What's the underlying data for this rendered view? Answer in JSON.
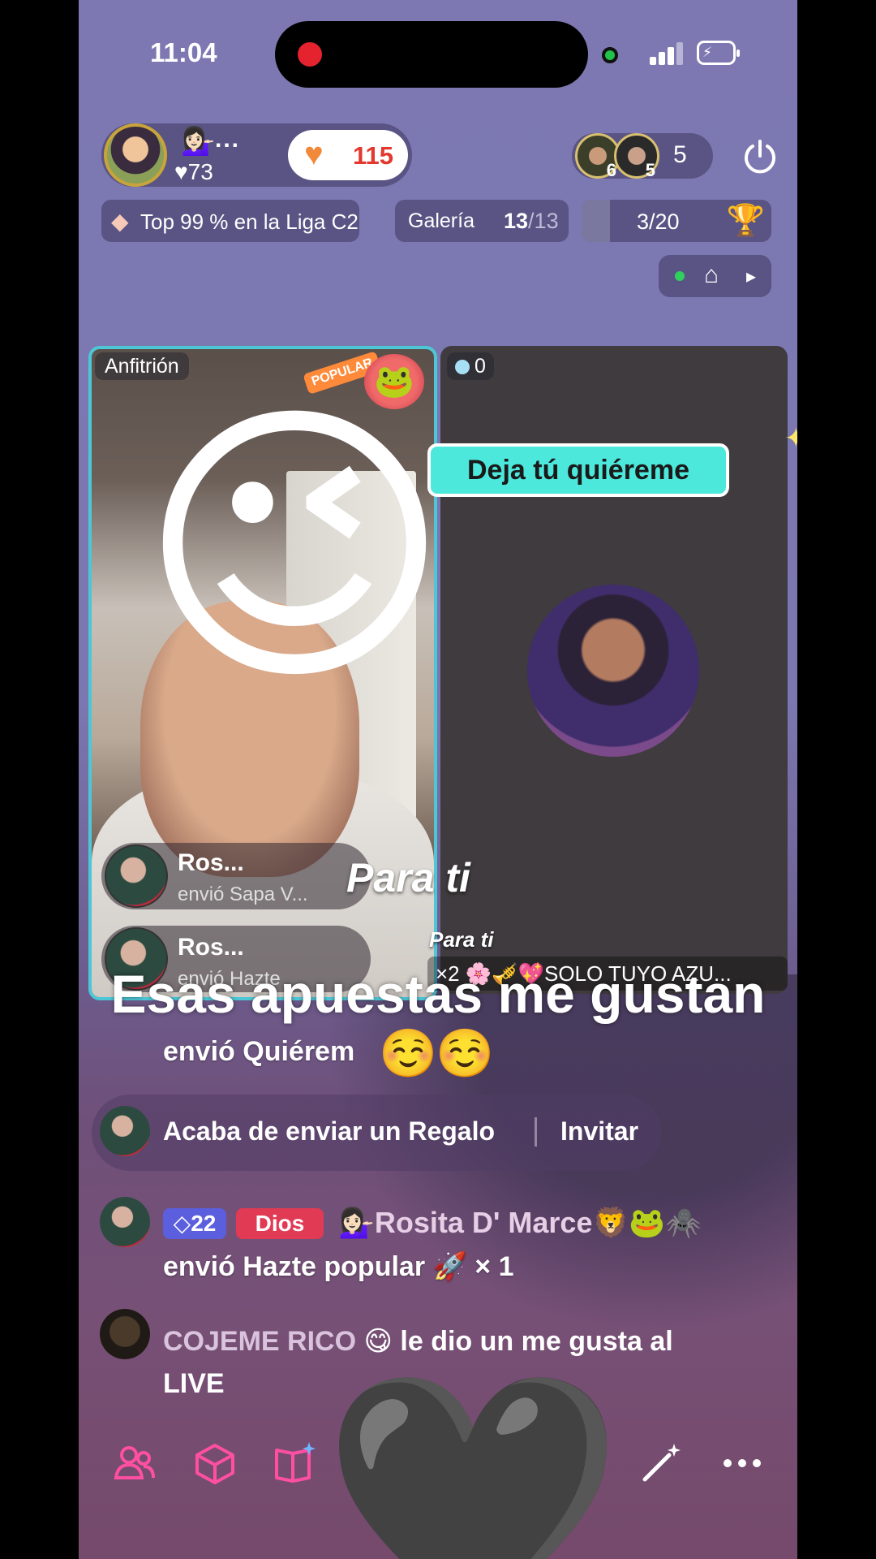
{
  "status_bar": {
    "time": "11:04",
    "battery_glyph": "⚡"
  },
  "host": {
    "name": "...",
    "likes_label": "♥73",
    "like_count": "115",
    "viewer_badges": [
      "6",
      "5"
    ],
    "viewer_count": "5"
  },
  "info_row": {
    "league": "Top 99 % en la Liga C2",
    "gallery_label": "Galería",
    "gallery_count": "13",
    "gallery_total": "/13",
    "progress_text": "3/20",
    "progress_fraction": 0.15
  },
  "stage": {
    "host_label": "Anfitrión",
    "guest_score": "0",
    "popular_badge": "POPULAR",
    "sapo_badge": "Sapo",
    "song_title": "Deja tú quiéreme"
  },
  "gifts": [
    {
      "name": "Ros...",
      "sub": "envió Sapa V..."
    },
    {
      "name": "Ros...",
      "sub": "envió Hazte"
    }
  ],
  "para_ti_big": "Para ti",
  "para_ti_small": "Para ti",
  "ticker": "×2 🌸🎺💖SOLO TUYO AZU...",
  "caption": "Esas apuestas me gustan",
  "chat": {
    "quiereme_line": "envió Quiérem",
    "invite": {
      "text": "Acaba de enviar un Regalo",
      "button": "Invitar"
    },
    "rosita": {
      "level": "22",
      "fan_badge": "Dios",
      "name": "Rosita D' Marce🦁🐸🕷️",
      "message": "envió Hazte popular 🚀 × 1"
    },
    "cojeme": {
      "name": "COJEME RICO",
      "emoji": "😋",
      "message": "le dio un me gusta al LIVE"
    }
  },
  "toolbar": {
    "icons": [
      "people-icon",
      "cube-icon",
      "book-sparkle-icon",
      "magic-wand-icon",
      "more-icon"
    ]
  },
  "colors": {
    "accent_cyan": "#4ce8dc",
    "like_red": "#e2382e",
    "level_blue": "#5b5fdd",
    "fan_red": "#e13a55"
  }
}
